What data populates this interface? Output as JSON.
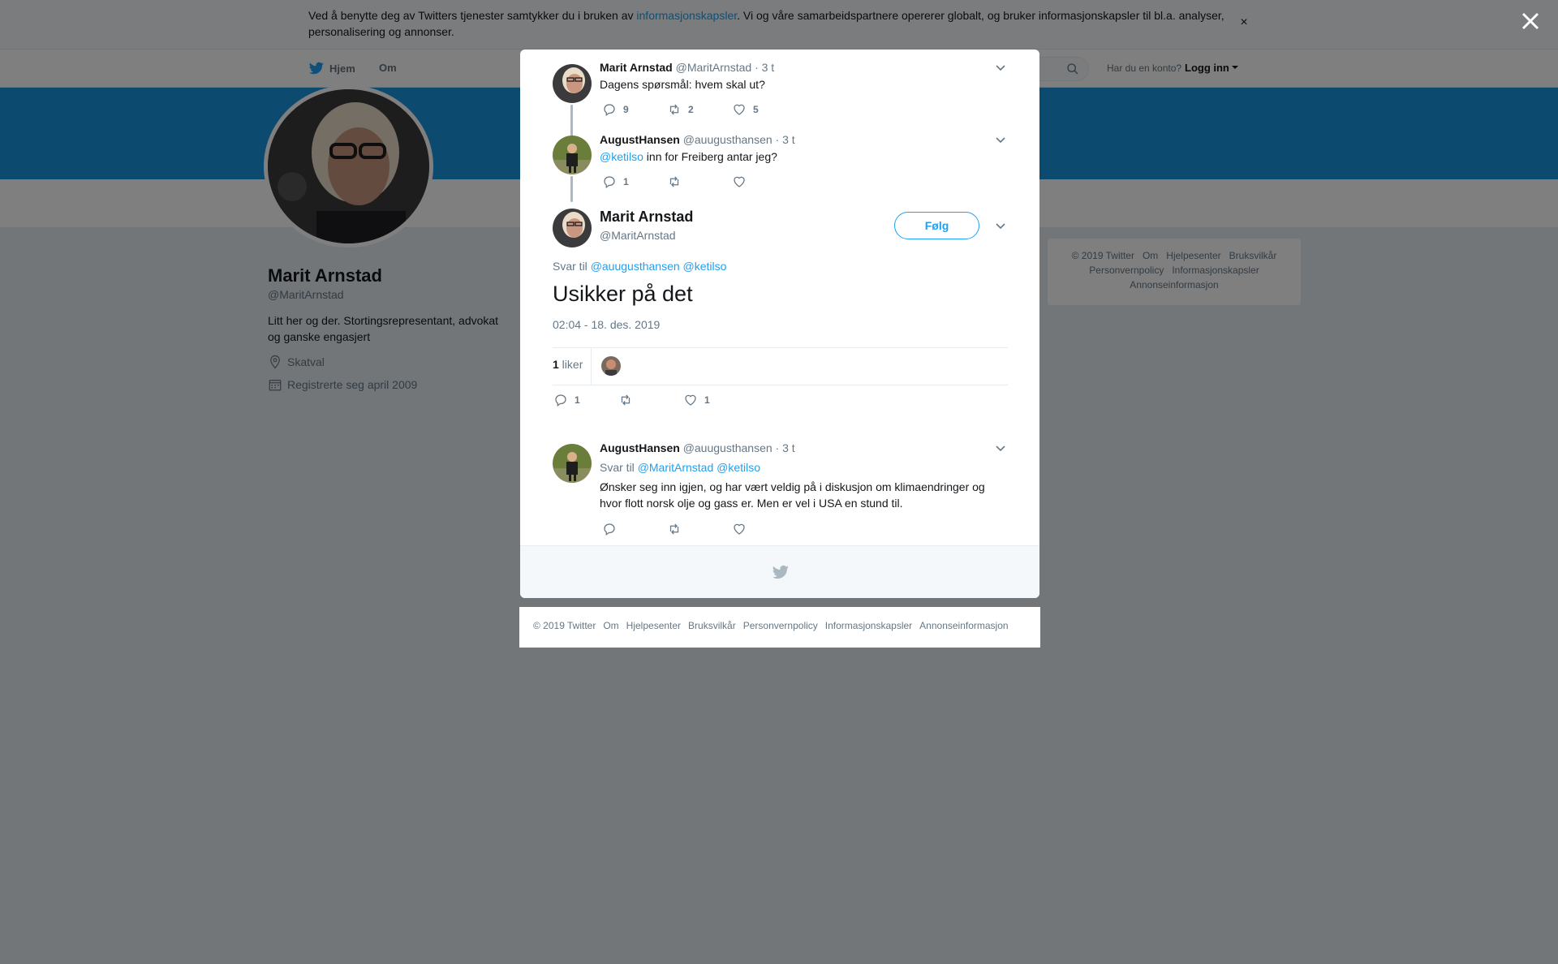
{
  "cookie": {
    "text_before": "Ved å benytte deg av Twitters tjenester samtykker du i bruken av ",
    "link": "informasjonskapsler",
    "text_after": ". Vi og våre samarbeidspartnere opererer globalt, og bruker informasjonskapsler til bl.a. analyser, personalisering og annonser.",
    "close": "×"
  },
  "nav": {
    "home": "Hjem",
    "about": "Om",
    "account_prompt": "Har du en konto?",
    "login": "Logg inn"
  },
  "profile": {
    "name": "Marit Arnstad",
    "handle": "@MaritArnstad",
    "bio": "Litt her og der. Stortingsrepresentant, advokat og ganske engasjert",
    "location": "Skatval",
    "joined": "Registrerte seg april 2009"
  },
  "right_footer": [
    "© 2019 Twitter",
    "Om",
    "Hjelpesenter",
    "Bruksvilkår",
    "Personvernpolicy",
    "Informasjonskapsler",
    "Annonseinformasjon"
  ],
  "thread": [
    {
      "name": "Marit Arnstad",
      "handle": "@MaritArnstad",
      "time": "· 3 t",
      "text": "Dagens spørsmål: hvem skal ut?",
      "replies": "9",
      "retweets": "2",
      "likes": "5"
    },
    {
      "name": "AugustHansen",
      "handle": "@auugusthansen",
      "time": "· 3 t",
      "mention": "@ketilso",
      "text": " inn for Freiberg antar jeg?",
      "replies": "1",
      "retweets": "",
      "likes": ""
    }
  ],
  "main_tweet": {
    "name": "Marit Arnstad",
    "handle": "@MaritArnstad",
    "follow": "Følg",
    "reply_prefix": "Svar til ",
    "reply_mentions": "@auugusthansen @ketilso",
    "text": "Usikker på det",
    "timestamp": "02:04 - 18. des. 2019",
    "likes_count": "1",
    "likes_label": " liker",
    "replies": "1",
    "retweets": "",
    "likes": "1"
  },
  "reply_tweet": {
    "name": "AugustHansen",
    "handle": "@auugusthansen",
    "time": "· 3 t",
    "reply_prefix": "Svar til ",
    "reply_mentions": "@MaritArnstad @ketilso",
    "text": "Ønsker seg inn igjen, og har vært veldig på i diskusjon om klimaendringer og hvor flott norsk olje og gass er. Men er vel i USA en stund til.",
    "replies": "",
    "retweets": "",
    "likes": ""
  },
  "bottom_footer": [
    "© 2019 Twitter",
    "Om",
    "Hjelpesenter",
    "Bruksvilkår",
    "Personvernpolicy",
    "Informasjonskapsler",
    "Annonseinformasjon"
  ],
  "colors": {
    "accent": "#1da1f2",
    "banner": "#1b95e0",
    "overlay": "rgba(0,0,0,0.5)"
  }
}
